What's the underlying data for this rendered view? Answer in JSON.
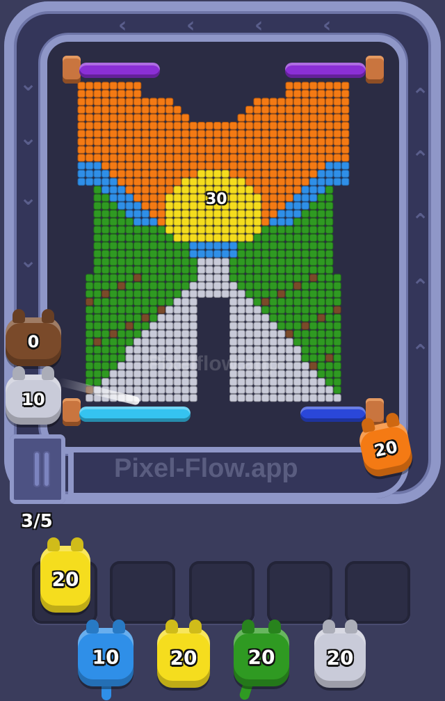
{
  "game": {
    "watermark_board": "Pixelflow.app",
    "watermark_conveyor": "Pixel-Flow.app",
    "queue_counter": "3/5",
    "board_target_label": "30"
  },
  "colors": {
    "background": "#3a3c5c",
    "track": "#8f97c8",
    "orange": "#f47a14",
    "blue": "#2f8fe8",
    "yellow": "#f5dd1e",
    "green": "#2f9a22",
    "brown": "#7a4a2a",
    "gray": "#c9cbd9",
    "purple": "#8b2fd6",
    "cyan": "#35c3f0",
    "navy": "#2a47d9"
  },
  "pipes": [
    {
      "name": "pipe-top-left",
      "color": "purple"
    },
    {
      "name": "pipe-top-right",
      "color": "purple"
    },
    {
      "name": "pipe-bottom-left",
      "color": "cyan"
    },
    {
      "name": "pipe-bottom-right",
      "color": "navy"
    }
  ],
  "track_critters": [
    {
      "name": "critter-brown",
      "color": "brown",
      "value": "0"
    },
    {
      "name": "critter-gray-shooter",
      "color": "gray",
      "value": "10"
    },
    {
      "name": "critter-orange-conveyor",
      "color": "orange",
      "value": "20"
    }
  ],
  "slots": [
    {
      "label": "slot-1",
      "critter": {
        "color": "yellow",
        "value": "20"
      }
    },
    {
      "label": "slot-2",
      "critter": null
    },
    {
      "label": "slot-3",
      "critter": null
    },
    {
      "label": "slot-4",
      "critter": null
    },
    {
      "label": "slot-5",
      "critter": null
    }
  ],
  "bottom_queue": [
    {
      "color": "blue",
      "value": "10"
    },
    {
      "color": "yellow",
      "value": "20"
    },
    {
      "color": "green",
      "value": "20"
    },
    {
      "color": "gray",
      "value": "20"
    }
  ],
  "icons": {
    "track_arrow_left": "‹",
    "track_arrow_down": "⌄",
    "track_arrow_up": "⌃"
  }
}
